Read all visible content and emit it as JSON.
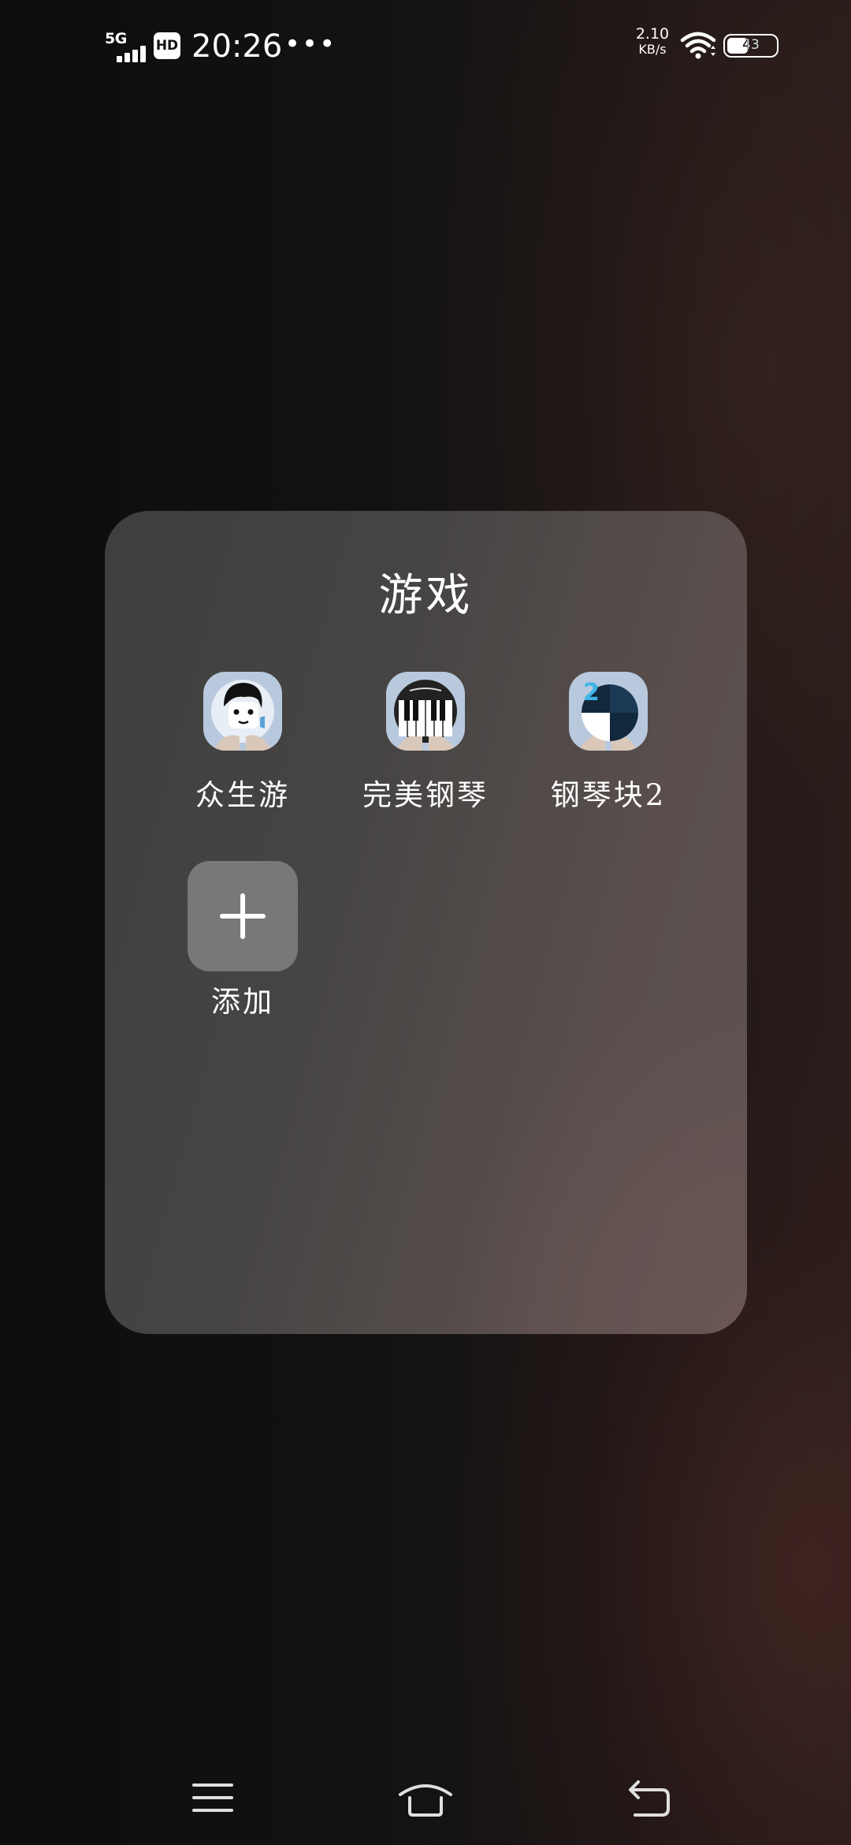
{
  "status_bar": {
    "network_type": "5G",
    "hd_label": "HD",
    "time": "20:26",
    "overflow_dots": "•••",
    "speed_value": "2.10",
    "speed_unit": "KB/s",
    "battery_percent": "43",
    "signal_bars": 4
  },
  "folder": {
    "title": "游戏",
    "apps": [
      {
        "label": "众生游",
        "icon": "zhongshengyou-app-icon"
      },
      {
        "label": "完美钢琴",
        "icon": "perfect-piano-app-icon"
      },
      {
        "label": "钢琴块2",
        "icon": "piano-tiles-2-app-icon"
      }
    ],
    "add": {
      "label": "添加",
      "icon": "plus-icon"
    }
  },
  "nav_bar": {
    "icons": [
      "menu-icon",
      "home-icon",
      "back-icon"
    ]
  }
}
